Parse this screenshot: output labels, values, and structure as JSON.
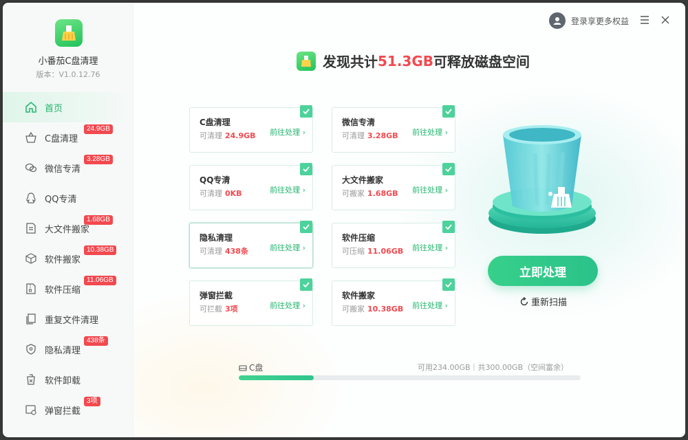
{
  "app": {
    "name": "小番茄C盘清理",
    "version": "版本：V1.0.12.76",
    "accent": "#21b66d",
    "badge_color": "#f2494f"
  },
  "sidebar": {
    "items": [
      {
        "label": "首页",
        "icon": "home-icon",
        "badge": ""
      },
      {
        "label": "C盘清理",
        "icon": "basket-icon",
        "badge": "24.9GB"
      },
      {
        "label": "微信专清",
        "icon": "wechat-icon",
        "badge": "3.28GB"
      },
      {
        "label": "QQ专清",
        "icon": "qq-icon",
        "badge": ""
      },
      {
        "label": "大文件搬家",
        "icon": "file-move-icon",
        "badge": "1.68GB"
      },
      {
        "label": "软件搬家",
        "icon": "box-icon",
        "badge": "10.38GB"
      },
      {
        "label": "软件压缩",
        "icon": "zip-icon",
        "badge": "11.06GB"
      },
      {
        "label": "重复文件清理",
        "icon": "duplicate-icon",
        "badge": ""
      },
      {
        "label": "隐私清理",
        "icon": "shield-icon",
        "badge": "438条"
      },
      {
        "label": "软件卸载",
        "icon": "uninstall-icon",
        "badge": ""
      },
      {
        "label": "弹窗拦截",
        "icon": "popup-icon",
        "badge": "3项"
      }
    ]
  },
  "topbar": {
    "login_text": "登录享更多权益",
    "menu_icon": "hamburger-icon",
    "close_icon": "close-icon"
  },
  "headline": {
    "prefix": "发现共计",
    "amount": "51.3GB",
    "suffix": "可释放磁盘空间"
  },
  "cards": [
    {
      "title": "C盘清理",
      "sub_label": "可清理",
      "value": "24.9GB",
      "go": "前往处理",
      "checked": true
    },
    {
      "title": "微信专清",
      "sub_label": "可清理",
      "value": "3.28GB",
      "go": "前往处理",
      "checked": true
    },
    {
      "title": "QQ专清",
      "sub_label": "可清理",
      "value": "0KB",
      "go": "前往处理",
      "checked": true
    },
    {
      "title": "大文件搬家",
      "sub_label": "可搬家",
      "value": "1.68GB",
      "go": "前往处理",
      "checked": true
    },
    {
      "title": "隐私清理",
      "sub_label": "可清理",
      "value": "438条",
      "go": "前往处理",
      "checked": true
    },
    {
      "title": "软件压缩",
      "sub_label": "可压缩",
      "value": "11.06GB",
      "go": "前往处理",
      "checked": true
    },
    {
      "title": "弹窗拦截",
      "sub_label": "可拦截",
      "value": "3项",
      "go": "前往处理",
      "checked": true
    },
    {
      "title": "软件搬家",
      "sub_label": "可搬家",
      "value": "10.38GB",
      "go": "前往处理",
      "checked": true
    }
  ],
  "actions": {
    "primary": "立即处理",
    "rescan": "重新扫描"
  },
  "disk": {
    "label": "C盘",
    "info": "可用234.00GB｜共300.00GB（空间富余）",
    "used_fraction": 0.22
  }
}
